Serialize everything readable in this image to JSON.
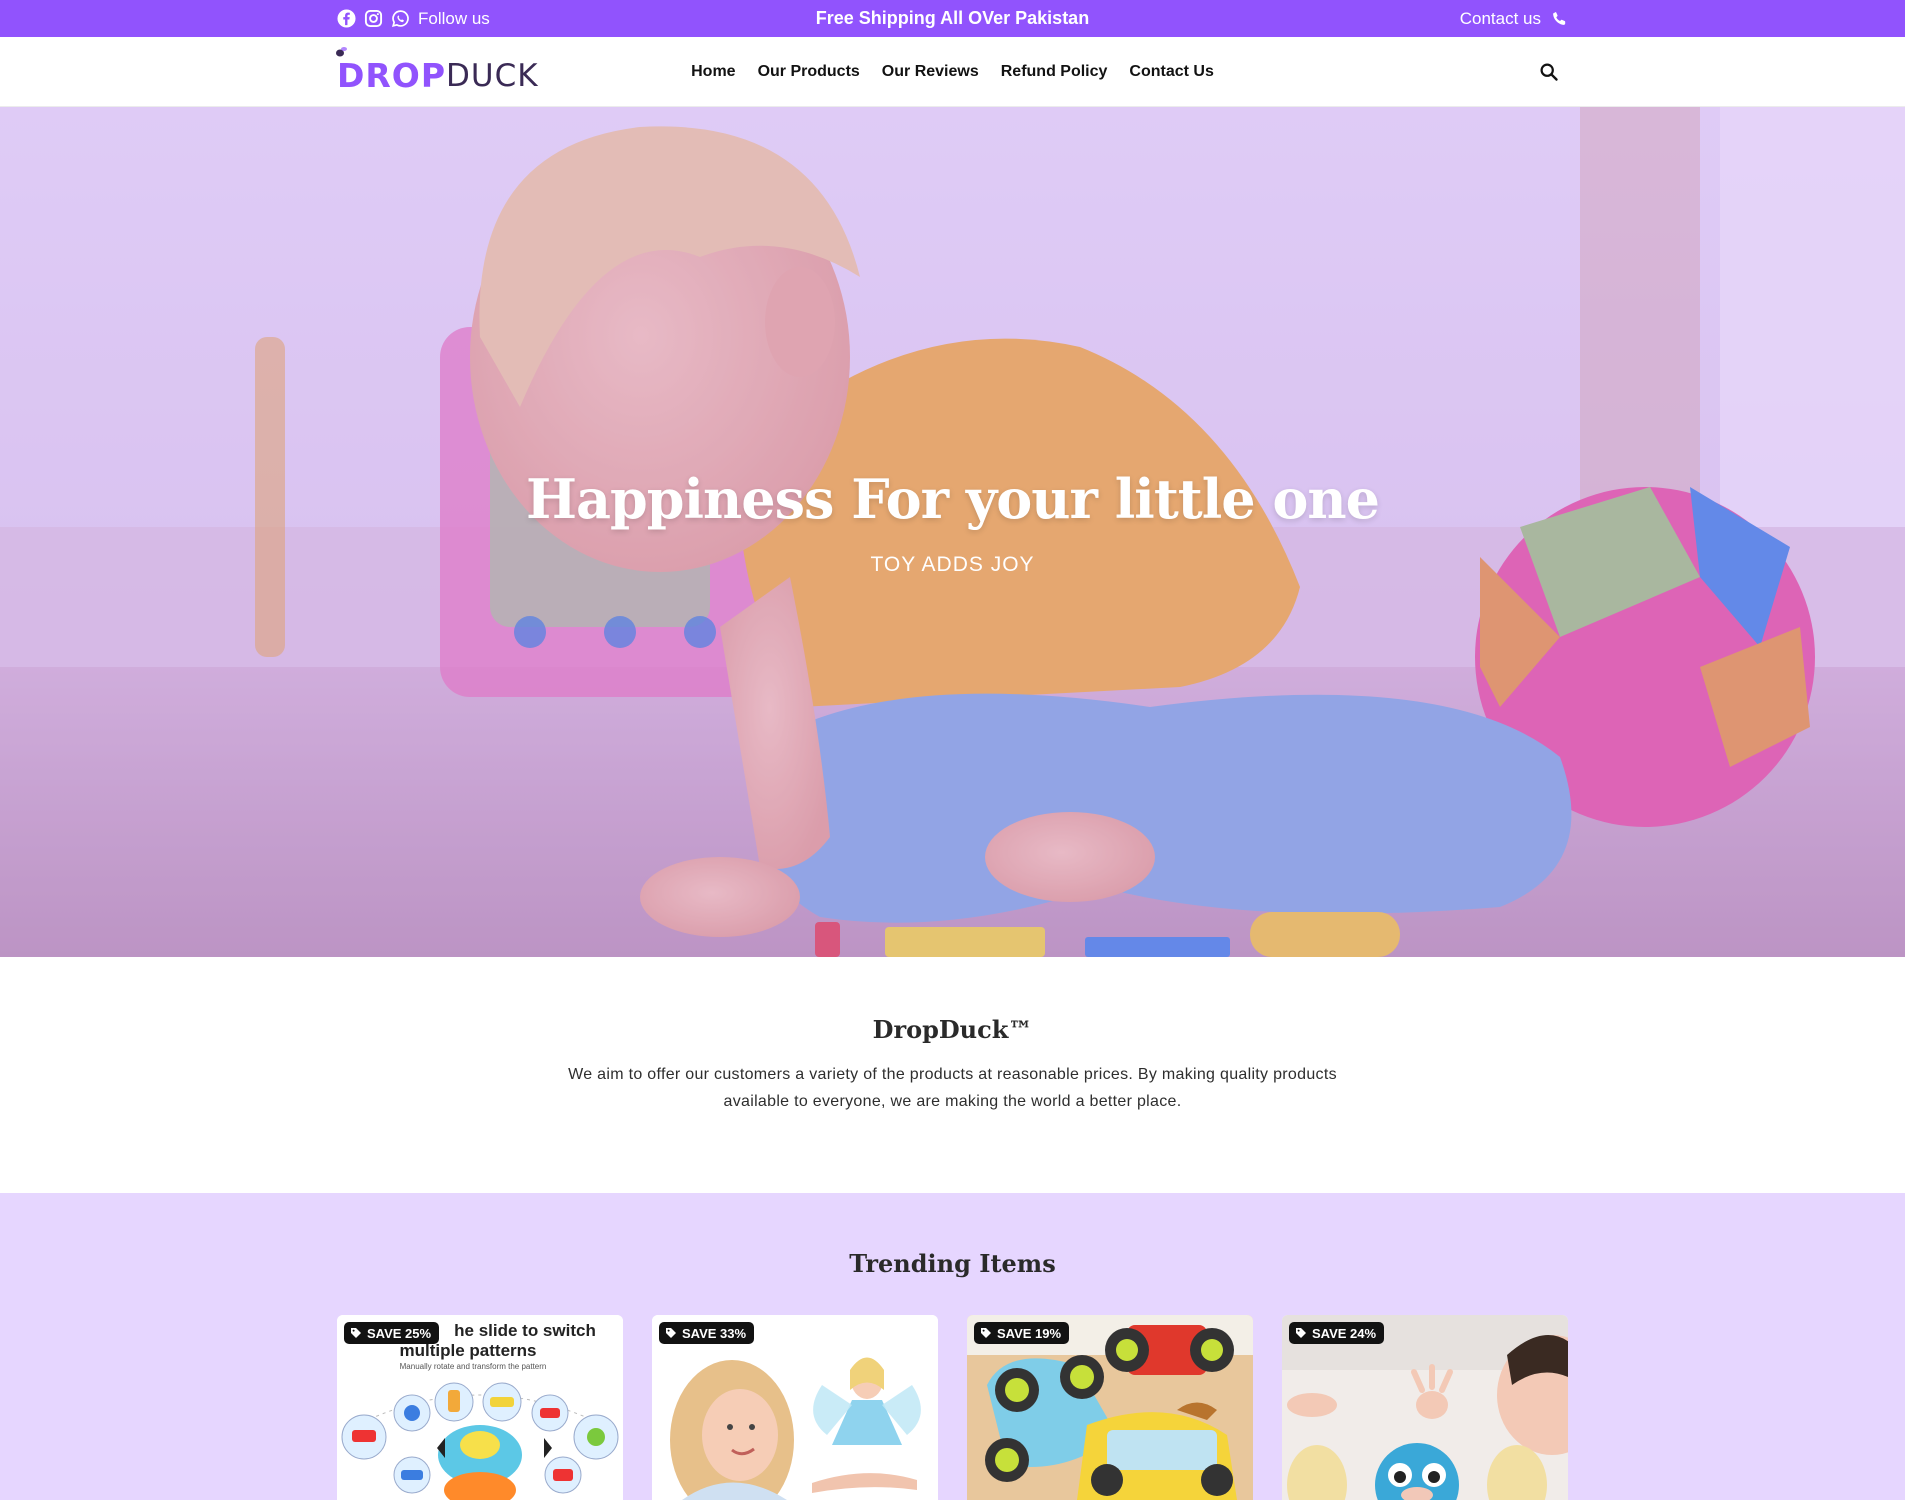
{
  "announcement": {
    "follow_label": "Follow us",
    "shipping_text": "Free Shipping All OVer Pakistan",
    "contact_label": "Contact us",
    "social_icons": [
      "facebook-icon",
      "instagram-icon",
      "whatsapp-icon"
    ],
    "background_color": "#9153fd"
  },
  "header": {
    "logo": {
      "part1": "DROP",
      "part2": "DUCK"
    },
    "nav": [
      "Home",
      "Our Products",
      "Our Reviews",
      "Refund Policy",
      "Contact Us"
    ],
    "search_icon": "search-icon"
  },
  "hero": {
    "title": "Happiness For your little one",
    "subtitle": "TOY ADDS JOY"
  },
  "about": {
    "title": "DropDuck™",
    "text": "We aim to offer our customers a variety of the products at reasonable prices. By making quality products available to everyone, we are making the world a better place."
  },
  "trending": {
    "title": "Trending Items",
    "products": [
      {
        "badge": "SAVE 25%",
        "image_caption_line1": "he slide to switch",
        "image_caption_line2": "multiple  patterns",
        "image_caption_line3": "Manually rotate and transform the pattern"
      },
      {
        "badge": "SAVE 33%"
      },
      {
        "badge": "SAVE 19%"
      },
      {
        "badge": "SAVE 24%"
      }
    ],
    "background_color": "#e6d6ff"
  }
}
